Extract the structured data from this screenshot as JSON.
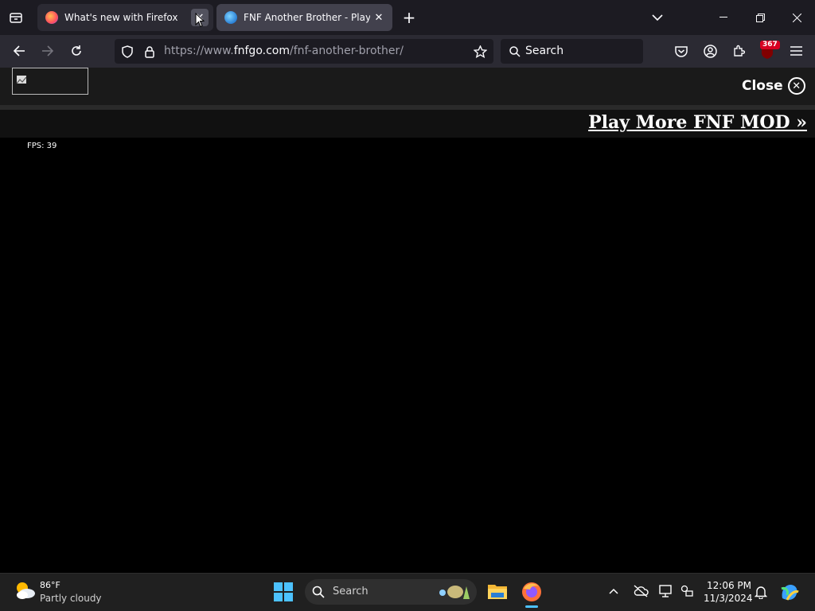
{
  "browser": {
    "tabs": [
      {
        "title": "What's new with Firefox",
        "active": false
      },
      {
        "title": "FNF Another Brother - Play Onl",
        "active": true
      }
    ],
    "url_prefix": "https://www.",
    "url_domain": "fnfgo.com",
    "url_path": "/fnf-another-brother/",
    "search_placeholder": "Search",
    "extension_badge": "367"
  },
  "page": {
    "close_label": "Close",
    "more_link": "Play More FNF MOD »",
    "fps": "FPS: 39"
  },
  "taskbar": {
    "weather_temp": "86°F",
    "weather_desc": "Partly cloudy",
    "search_placeholder": "Search",
    "time": "12:06 PM",
    "date": "11/3/2024"
  },
  "colors": {
    "accent": "#0060df",
    "tab_active": "#42414d",
    "toolbar": "#2b2a33",
    "badge": "#d70022"
  }
}
